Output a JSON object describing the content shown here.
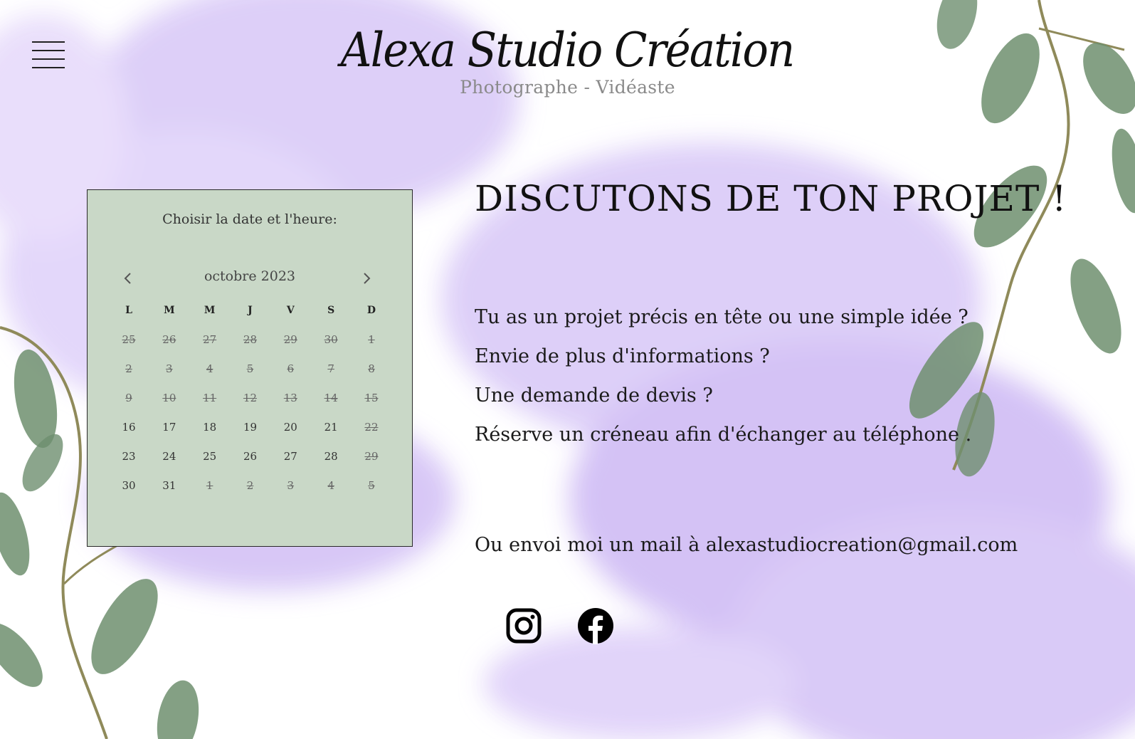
{
  "header": {
    "brand_title": "Alexa Studio Création",
    "brand_subtitle": "Photographe - Vidéaste"
  },
  "icons": {
    "menu": "hamburger-menu-icon",
    "prev": "chevron-left-icon",
    "next": "chevron-right-icon",
    "instagram": "instagram-icon",
    "facebook": "facebook-icon"
  },
  "calendar": {
    "heading": "Choisir la date et l'heure:",
    "month": "octobre 2023",
    "weekdays": [
      "L",
      "M",
      "M",
      "J",
      "V",
      "S",
      "D"
    ],
    "weeks": [
      [
        {
          "d": "25",
          "available": false
        },
        {
          "d": "26",
          "available": false
        },
        {
          "d": "27",
          "available": false
        },
        {
          "d": "28",
          "available": false
        },
        {
          "d": "29",
          "available": false
        },
        {
          "d": "30",
          "available": false
        },
        {
          "d": "1",
          "available": false
        }
      ],
      [
        {
          "d": "2",
          "available": false
        },
        {
          "d": "3",
          "available": false
        },
        {
          "d": "4",
          "available": false
        },
        {
          "d": "5",
          "available": false
        },
        {
          "d": "6",
          "available": false
        },
        {
          "d": "7",
          "available": false
        },
        {
          "d": "8",
          "available": false
        }
      ],
      [
        {
          "d": "9",
          "available": false
        },
        {
          "d": "10",
          "available": false
        },
        {
          "d": "11",
          "available": false
        },
        {
          "d": "12",
          "available": false
        },
        {
          "d": "13",
          "available": false
        },
        {
          "d": "14",
          "available": false
        },
        {
          "d": "15",
          "available": false
        }
      ],
      [
        {
          "d": "16",
          "available": true
        },
        {
          "d": "17",
          "available": true
        },
        {
          "d": "18",
          "available": true
        },
        {
          "d": "19",
          "available": true
        },
        {
          "d": "20",
          "available": true
        },
        {
          "d": "21",
          "available": true
        },
        {
          "d": "22",
          "available": false
        }
      ],
      [
        {
          "d": "23",
          "available": true
        },
        {
          "d": "24",
          "available": true
        },
        {
          "d": "25",
          "available": true
        },
        {
          "d": "26",
          "available": true
        },
        {
          "d": "27",
          "available": true
        },
        {
          "d": "28",
          "available": true
        },
        {
          "d": "29",
          "available": false
        }
      ],
      [
        {
          "d": "30",
          "available": true
        },
        {
          "d": "31",
          "available": true
        },
        {
          "d": "1",
          "available": false
        },
        {
          "d": "2",
          "available": false
        },
        {
          "d": "3",
          "available": false
        },
        {
          "d": "4",
          "available": false
        },
        {
          "d": "5",
          "available": false
        }
      ]
    ]
  },
  "content": {
    "title": "DISCUTONS DE TON PROJET !",
    "lines": [
      "Tu as un projet précis en tête ou une simple idée ?",
      "Envie de plus d'informations ?",
      "Une demande de devis ?",
      "Réserve un créneau afin d'échanger au téléphone ."
    ],
    "email_prefix": "Ou envoi moi un mail à ",
    "email": "alexastudiocreation@gmail.com"
  },
  "colors": {
    "lilac": "#d9c9f7",
    "lilac_dark": "#c6b1f0",
    "leaf": "#6e8f6f",
    "stem": "#8f8a5a",
    "calendar_bg": "#c9d8c7"
  }
}
